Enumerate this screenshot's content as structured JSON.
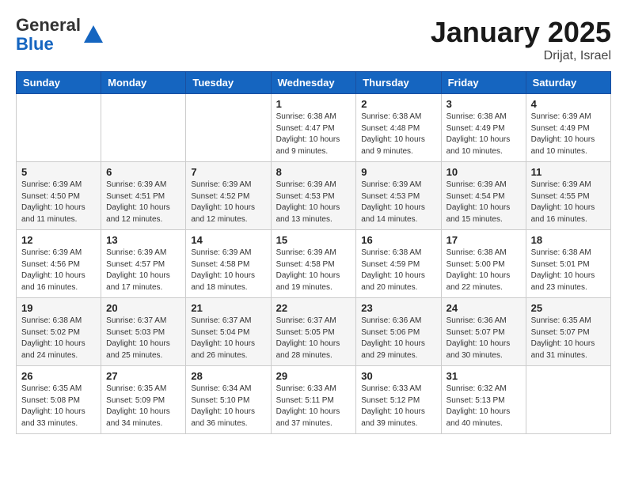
{
  "header": {
    "logo_general": "General",
    "logo_blue": "Blue",
    "month_title": "January 2025",
    "location": "Drijat, Israel"
  },
  "days_of_week": [
    "Sunday",
    "Monday",
    "Tuesday",
    "Wednesday",
    "Thursday",
    "Friday",
    "Saturday"
  ],
  "weeks": [
    [
      {
        "day": "",
        "info": ""
      },
      {
        "day": "",
        "info": ""
      },
      {
        "day": "",
        "info": ""
      },
      {
        "day": "1",
        "info": "Sunrise: 6:38 AM\nSunset: 4:47 PM\nDaylight: 10 hours and 9 minutes."
      },
      {
        "day": "2",
        "info": "Sunrise: 6:38 AM\nSunset: 4:48 PM\nDaylight: 10 hours and 9 minutes."
      },
      {
        "day": "3",
        "info": "Sunrise: 6:38 AM\nSunset: 4:49 PM\nDaylight: 10 hours and 10 minutes."
      },
      {
        "day": "4",
        "info": "Sunrise: 6:39 AM\nSunset: 4:49 PM\nDaylight: 10 hours and 10 minutes."
      }
    ],
    [
      {
        "day": "5",
        "info": "Sunrise: 6:39 AM\nSunset: 4:50 PM\nDaylight: 10 hours and 11 minutes."
      },
      {
        "day": "6",
        "info": "Sunrise: 6:39 AM\nSunset: 4:51 PM\nDaylight: 10 hours and 12 minutes."
      },
      {
        "day": "7",
        "info": "Sunrise: 6:39 AM\nSunset: 4:52 PM\nDaylight: 10 hours and 12 minutes."
      },
      {
        "day": "8",
        "info": "Sunrise: 6:39 AM\nSunset: 4:53 PM\nDaylight: 10 hours and 13 minutes."
      },
      {
        "day": "9",
        "info": "Sunrise: 6:39 AM\nSunset: 4:53 PM\nDaylight: 10 hours and 14 minutes."
      },
      {
        "day": "10",
        "info": "Sunrise: 6:39 AM\nSunset: 4:54 PM\nDaylight: 10 hours and 15 minutes."
      },
      {
        "day": "11",
        "info": "Sunrise: 6:39 AM\nSunset: 4:55 PM\nDaylight: 10 hours and 16 minutes."
      }
    ],
    [
      {
        "day": "12",
        "info": "Sunrise: 6:39 AM\nSunset: 4:56 PM\nDaylight: 10 hours and 16 minutes."
      },
      {
        "day": "13",
        "info": "Sunrise: 6:39 AM\nSunset: 4:57 PM\nDaylight: 10 hours and 17 minutes."
      },
      {
        "day": "14",
        "info": "Sunrise: 6:39 AM\nSunset: 4:58 PM\nDaylight: 10 hours and 18 minutes."
      },
      {
        "day": "15",
        "info": "Sunrise: 6:39 AM\nSunset: 4:58 PM\nDaylight: 10 hours and 19 minutes."
      },
      {
        "day": "16",
        "info": "Sunrise: 6:38 AM\nSunset: 4:59 PM\nDaylight: 10 hours and 20 minutes."
      },
      {
        "day": "17",
        "info": "Sunrise: 6:38 AM\nSunset: 5:00 PM\nDaylight: 10 hours and 22 minutes."
      },
      {
        "day": "18",
        "info": "Sunrise: 6:38 AM\nSunset: 5:01 PM\nDaylight: 10 hours and 23 minutes."
      }
    ],
    [
      {
        "day": "19",
        "info": "Sunrise: 6:38 AM\nSunset: 5:02 PM\nDaylight: 10 hours and 24 minutes."
      },
      {
        "day": "20",
        "info": "Sunrise: 6:37 AM\nSunset: 5:03 PM\nDaylight: 10 hours and 25 minutes."
      },
      {
        "day": "21",
        "info": "Sunrise: 6:37 AM\nSunset: 5:04 PM\nDaylight: 10 hours and 26 minutes."
      },
      {
        "day": "22",
        "info": "Sunrise: 6:37 AM\nSunset: 5:05 PM\nDaylight: 10 hours and 28 minutes."
      },
      {
        "day": "23",
        "info": "Sunrise: 6:36 AM\nSunset: 5:06 PM\nDaylight: 10 hours and 29 minutes."
      },
      {
        "day": "24",
        "info": "Sunrise: 6:36 AM\nSunset: 5:07 PM\nDaylight: 10 hours and 30 minutes."
      },
      {
        "day": "25",
        "info": "Sunrise: 6:35 AM\nSunset: 5:07 PM\nDaylight: 10 hours and 31 minutes."
      }
    ],
    [
      {
        "day": "26",
        "info": "Sunrise: 6:35 AM\nSunset: 5:08 PM\nDaylight: 10 hours and 33 minutes."
      },
      {
        "day": "27",
        "info": "Sunrise: 6:35 AM\nSunset: 5:09 PM\nDaylight: 10 hours and 34 minutes."
      },
      {
        "day": "28",
        "info": "Sunrise: 6:34 AM\nSunset: 5:10 PM\nDaylight: 10 hours and 36 minutes."
      },
      {
        "day": "29",
        "info": "Sunrise: 6:33 AM\nSunset: 5:11 PM\nDaylight: 10 hours and 37 minutes."
      },
      {
        "day": "30",
        "info": "Sunrise: 6:33 AM\nSunset: 5:12 PM\nDaylight: 10 hours and 39 minutes."
      },
      {
        "day": "31",
        "info": "Sunrise: 6:32 AM\nSunset: 5:13 PM\nDaylight: 10 hours and 40 minutes."
      },
      {
        "day": "",
        "info": ""
      }
    ]
  ]
}
